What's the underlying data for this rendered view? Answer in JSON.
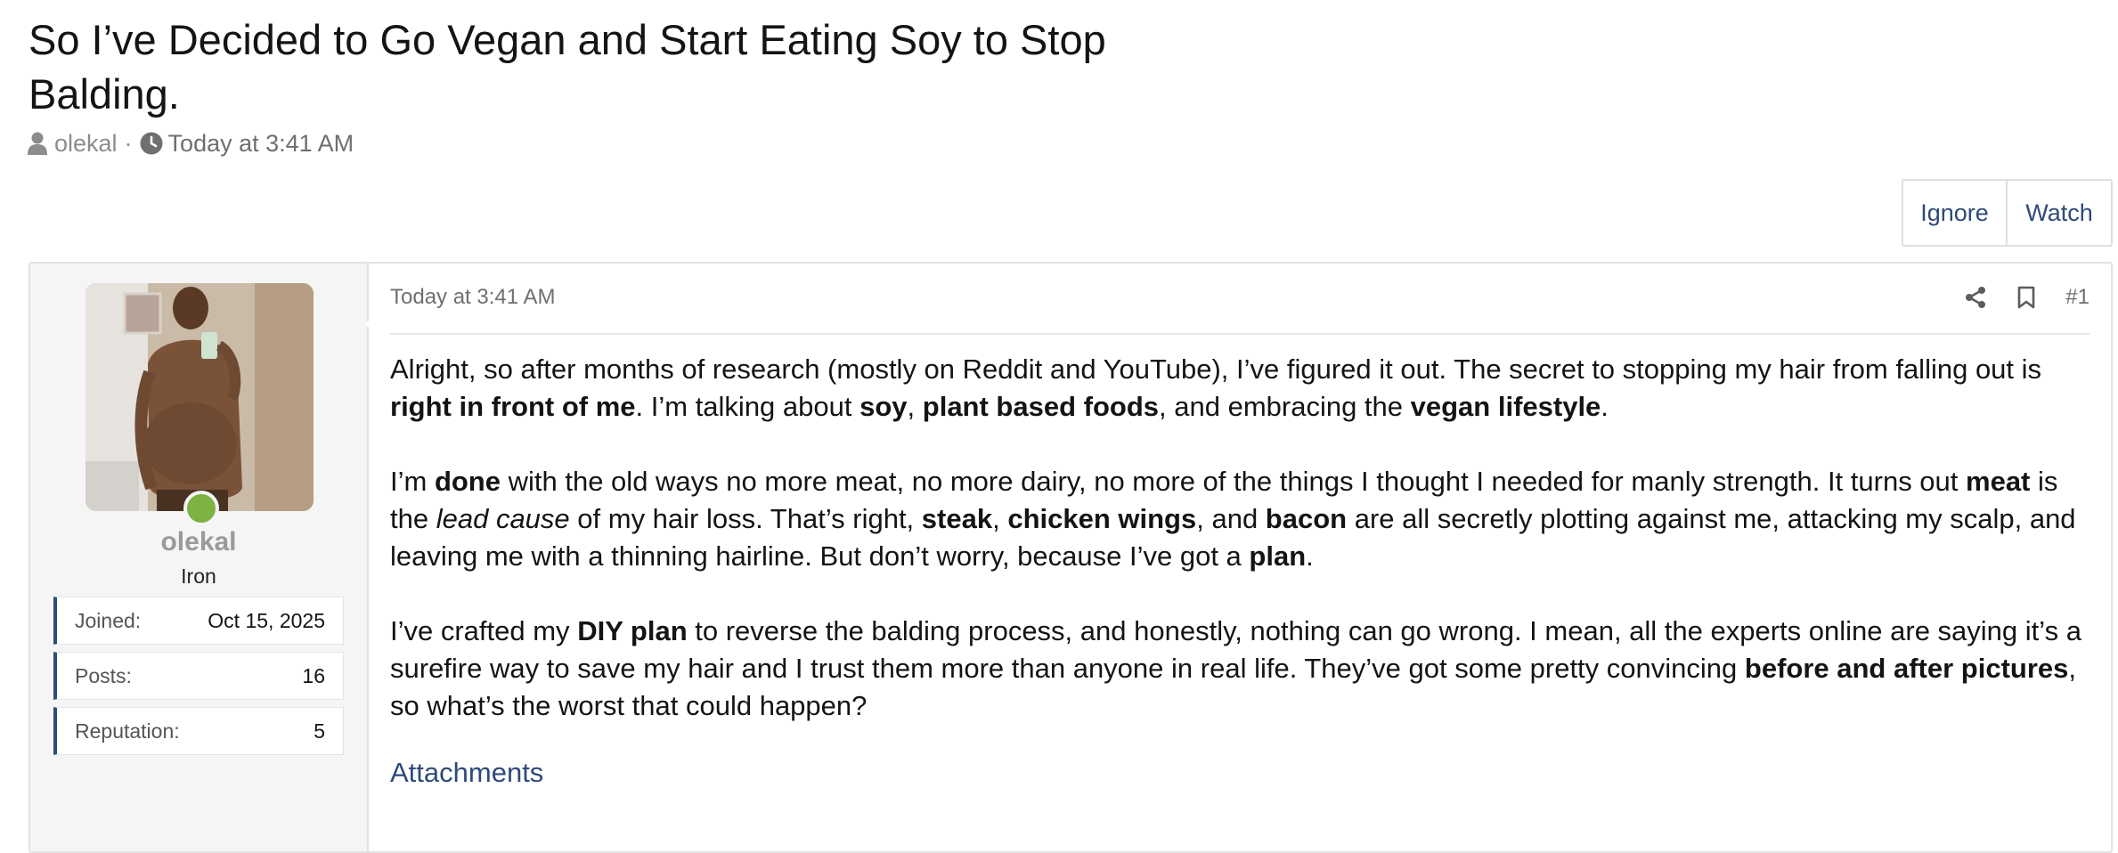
{
  "thread": {
    "title": "So I’ve Decided to Go Vegan and Start Eating Soy to Stop Balding.",
    "author": "olekal",
    "separator": "·",
    "date": "Today at 3:41 AM"
  },
  "actions": {
    "ignore": "Ignore",
    "watch": "Watch"
  },
  "user": {
    "name": "olekal",
    "title": "Iron",
    "stats": [
      {
        "label": "Joined:",
        "value": "Oct 15, 2025"
      },
      {
        "label": "Posts:",
        "value": "16"
      },
      {
        "label": "Reputation:",
        "value": "5"
      }
    ]
  },
  "post": {
    "date": "Today at 3:41 AM",
    "number": "#1",
    "p1": [
      "Alright, so after months of research (mostly on Reddit and YouTube), I’ve figured it out. The secret to stopping my hair from falling out is ",
      "right in front of me",
      ". I’m talking about ",
      "soy",
      ", ",
      "plant based foods",
      ", and embracing the ",
      "vegan lifestyle",
      "."
    ],
    "p2": [
      "I’m ",
      "done",
      " with the old ways no more meat, no more dairy, no more of the things I thought I needed for manly strength. It turns out ",
      "meat",
      " is the ",
      "lead cause",
      " of my hair loss. That’s right, ",
      "steak",
      ", ",
      "chicken wings",
      ", and ",
      "bacon",
      " are all secretly plotting against me, attacking my scalp, and leaving me with a thinning hairline. But don’t worry, because I’ve got a ",
      "plan",
      "."
    ],
    "p3": [
      "I’ve crafted my ",
      "DIY plan",
      " to reverse the balding process, and honestly, nothing can go wrong. I mean, all the experts online are saying it’s a surefire way to save my hair and I trust them more than anyone in real life. They’ve got some pretty convincing ",
      "before and after pictures",
      ", so what’s the worst that could happen?"
    ],
    "attachments_label": "Attachments"
  },
  "icons": [
    "user-icon",
    "clock-icon",
    "share-icon",
    "bookmark-icon"
  ],
  "colors": {
    "accent": "#2f4a7a",
    "online": "#7cb342",
    "stat_border": "#2c4d7c"
  }
}
